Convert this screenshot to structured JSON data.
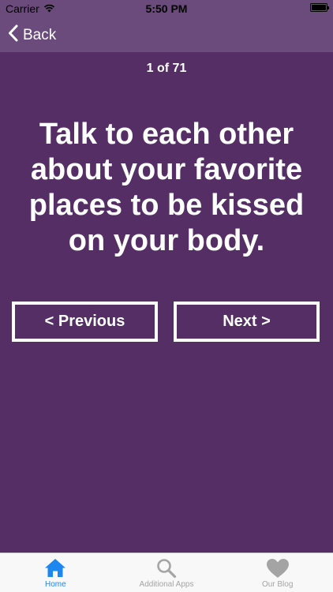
{
  "status_bar": {
    "carrier": "Carrier",
    "time": "5:50 PM"
  },
  "nav": {
    "back_label": "Back"
  },
  "card": {
    "counter": "1 of 71",
    "prompt": "Talk to each other about your favorite places to be kissed on your body."
  },
  "buttons": {
    "previous": "< Previous",
    "next": "Next >"
  },
  "tabbar": {
    "items": [
      {
        "label": "Home",
        "icon": "home-icon",
        "active": true
      },
      {
        "label": "Additional Apps",
        "icon": "search-icon",
        "active": false
      },
      {
        "label": "Our Blog",
        "icon": "heart-icon",
        "active": false
      }
    ]
  },
  "colors": {
    "background": "#542e64",
    "nav_bar": "#6b4b7b",
    "active_tab": "#1d86ef",
    "inactive_tab": "#a4a4a4"
  }
}
